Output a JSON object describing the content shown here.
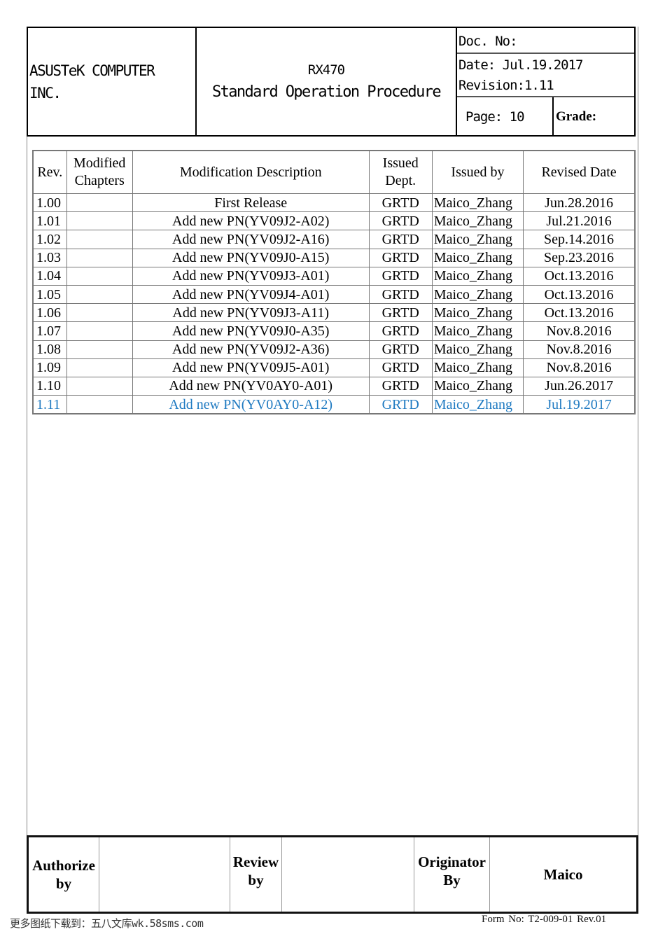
{
  "header": {
    "company_line1": "ASUSTeK COMPUTER",
    "company_line2": "INC.",
    "model": "RX470",
    "title": "Standard Operation Procedure",
    "doc_no": "Doc. No:",
    "date": "Date: Jul.19.2017",
    "revision": "Revision:1.11",
    "page": "Page: 10",
    "grade": "Grade:"
  },
  "revision_table": {
    "columns": [
      "Rev.",
      "Modified Chapters",
      "Modification Description",
      "Issued Dept.",
      "Issued by",
      "Revised Date"
    ],
    "column_lines": {
      "modified": [
        "Modified",
        "Chapters"
      ],
      "issued_dept": [
        "Issued",
        "Dept."
      ]
    },
    "highlight_color": "#1f7ac1",
    "rows": [
      {
        "rev": "1.00",
        "chapters": "",
        "description": "First Release",
        "dept": "GRTD",
        "by": "Maico_Zhang",
        "date": "Jun.28.2016"
      },
      {
        "rev": "1.01",
        "chapters": "",
        "description": "Add new PN(YV09J2-A02)",
        "dept": "GRTD",
        "by": "Maico_Zhang",
        "date": "Jul.21.2016"
      },
      {
        "rev": "1.02",
        "chapters": "",
        "description": "Add new PN(YV09J2-A16)",
        "dept": "GRTD",
        "by": "Maico_Zhang",
        "date": "Sep.14.2016"
      },
      {
        "rev": "1.03",
        "chapters": "",
        "description": "Add new PN(YV09J0-A15)",
        "dept": "GRTD",
        "by": "Maico_Zhang",
        "date": "Sep.23.2016"
      },
      {
        "rev": "1.04",
        "chapters": "",
        "description": "Add new PN(YV09J3-A01)",
        "dept": "GRTD",
        "by": "Maico_Zhang",
        "date": "Oct.13.2016"
      },
      {
        "rev": "1.05",
        "chapters": "",
        "description": "Add new PN(YV09J4-A01)",
        "dept": "GRTD",
        "by": "Maico_Zhang",
        "date": "Oct.13.2016"
      },
      {
        "rev": "1.06",
        "chapters": "",
        "description": "Add new PN(YV09J3-A11)",
        "dept": "GRTD",
        "by": "Maico_Zhang",
        "date": "Oct.13.2016"
      },
      {
        "rev": "1.07",
        "chapters": "",
        "description": "Add new PN(YV09J0-A35)",
        "dept": "GRTD",
        "by": "Maico_Zhang",
        "date": "Nov.8.2016"
      },
      {
        "rev": "1.08",
        "chapters": "",
        "description": "Add new PN(YV09J2-A36)",
        "dept": "GRTD",
        "by": "Maico_Zhang",
        "date": "Nov.8.2016"
      },
      {
        "rev": "1.09",
        "chapters": "",
        "description": "Add new PN(YV09J5-A01)",
        "dept": "GRTD",
        "by": "Maico_Zhang",
        "date": "Nov.8.2016"
      },
      {
        "rev": "1.10",
        "chapters": "",
        "description": "Add new PN(YV0AY0-A01)",
        "dept": "GRTD",
        "by": "Maico_Zhang",
        "date": "Jun.26.2017"
      },
      {
        "rev": "1.11",
        "chapters": "",
        "description": "Add new PN(YV0AY0-A12)",
        "dept": "GRTD",
        "by": "Maico_Zhang",
        "date": "Jul.19.2017",
        "current": true
      }
    ]
  },
  "signatures": {
    "authorize_label": [
      "Authorize",
      "by"
    ],
    "authorize_value": "",
    "review_label": [
      "Review",
      "by"
    ],
    "review_value": "",
    "originator_label": [
      "Originator",
      "By"
    ],
    "originator_value": "Maico"
  },
  "footer": {
    "watermark": "更多图纸下载到：五八文库wk.58sms.com",
    "form_no": "Form  No:  T2-009-01  Rev.01"
  }
}
